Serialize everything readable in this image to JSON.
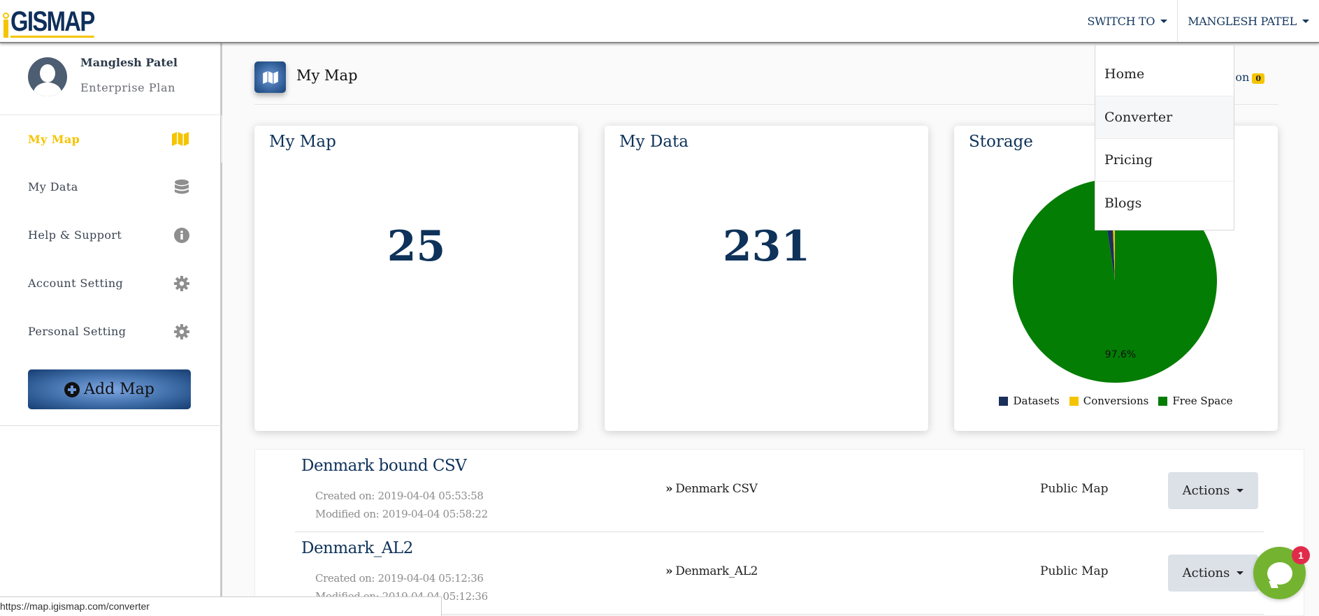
{
  "header": {
    "logo_text": "GISMAP",
    "switch_to_label": "SWITCH TO",
    "user_menu_label": "MANGLESH PATEL"
  },
  "switch_to_menu": {
    "items": [
      {
        "label": "Home"
      },
      {
        "label": "Converter"
      },
      {
        "label": "Pricing"
      },
      {
        "label": "Blogs"
      }
    ]
  },
  "sidebar": {
    "profile": {
      "name": "Manglesh Patel",
      "plan": "Enterprise Plan"
    },
    "items": [
      {
        "label": "My Map",
        "icon": "map-icon",
        "active": true
      },
      {
        "label": "My Data",
        "icon": "database-icon"
      },
      {
        "label": "Help & Support",
        "icon": "info-icon"
      },
      {
        "label": "Account Setting",
        "icon": "gear-icon"
      },
      {
        "label": "Personal Setting",
        "icon": "gear-icon"
      }
    ],
    "add_map_label": "Add Map"
  },
  "page": {
    "title": "My Map",
    "notification_label": "on",
    "notification_count": "0"
  },
  "cards": {
    "my_map": {
      "title": "My Map",
      "value": "25"
    },
    "my_data": {
      "title": "My Data",
      "value": "231"
    },
    "storage": {
      "title": "Storage"
    }
  },
  "chart_data": {
    "type": "pie",
    "title": "Storage",
    "labels": [
      "Datasets",
      "Conversions",
      "Free Space"
    ],
    "values": [
      1.8,
      0.6,
      97.6
    ],
    "colors": [
      "#1a2f5a",
      "#f5c400",
      "#037d03"
    ],
    "data_labels": [
      "",
      "",
      "97.6%"
    ],
    "legend_position": "bottom"
  },
  "maps": [
    {
      "title": "Denmark bound CSV",
      "created": "Created on: 2019-04-04 05:53:58",
      "modified": "Modified on: 2019-04-04 05:58:22",
      "dataset": "Denmark CSV",
      "visibility": "Public Map",
      "actions_label": "Actions"
    },
    {
      "title": "Denmark_AL2",
      "created": "Created on: 2019-04-04 05:12:36",
      "modified": "Modified on: 2019-04-04 05:12:36",
      "dataset": "Denmark_AL2",
      "visibility": "Public Map",
      "actions_label": "Actions"
    }
  ],
  "status_bar": {
    "url": "https://map.igismap.com/converter"
  },
  "chat": {
    "unread_count": "1"
  }
}
